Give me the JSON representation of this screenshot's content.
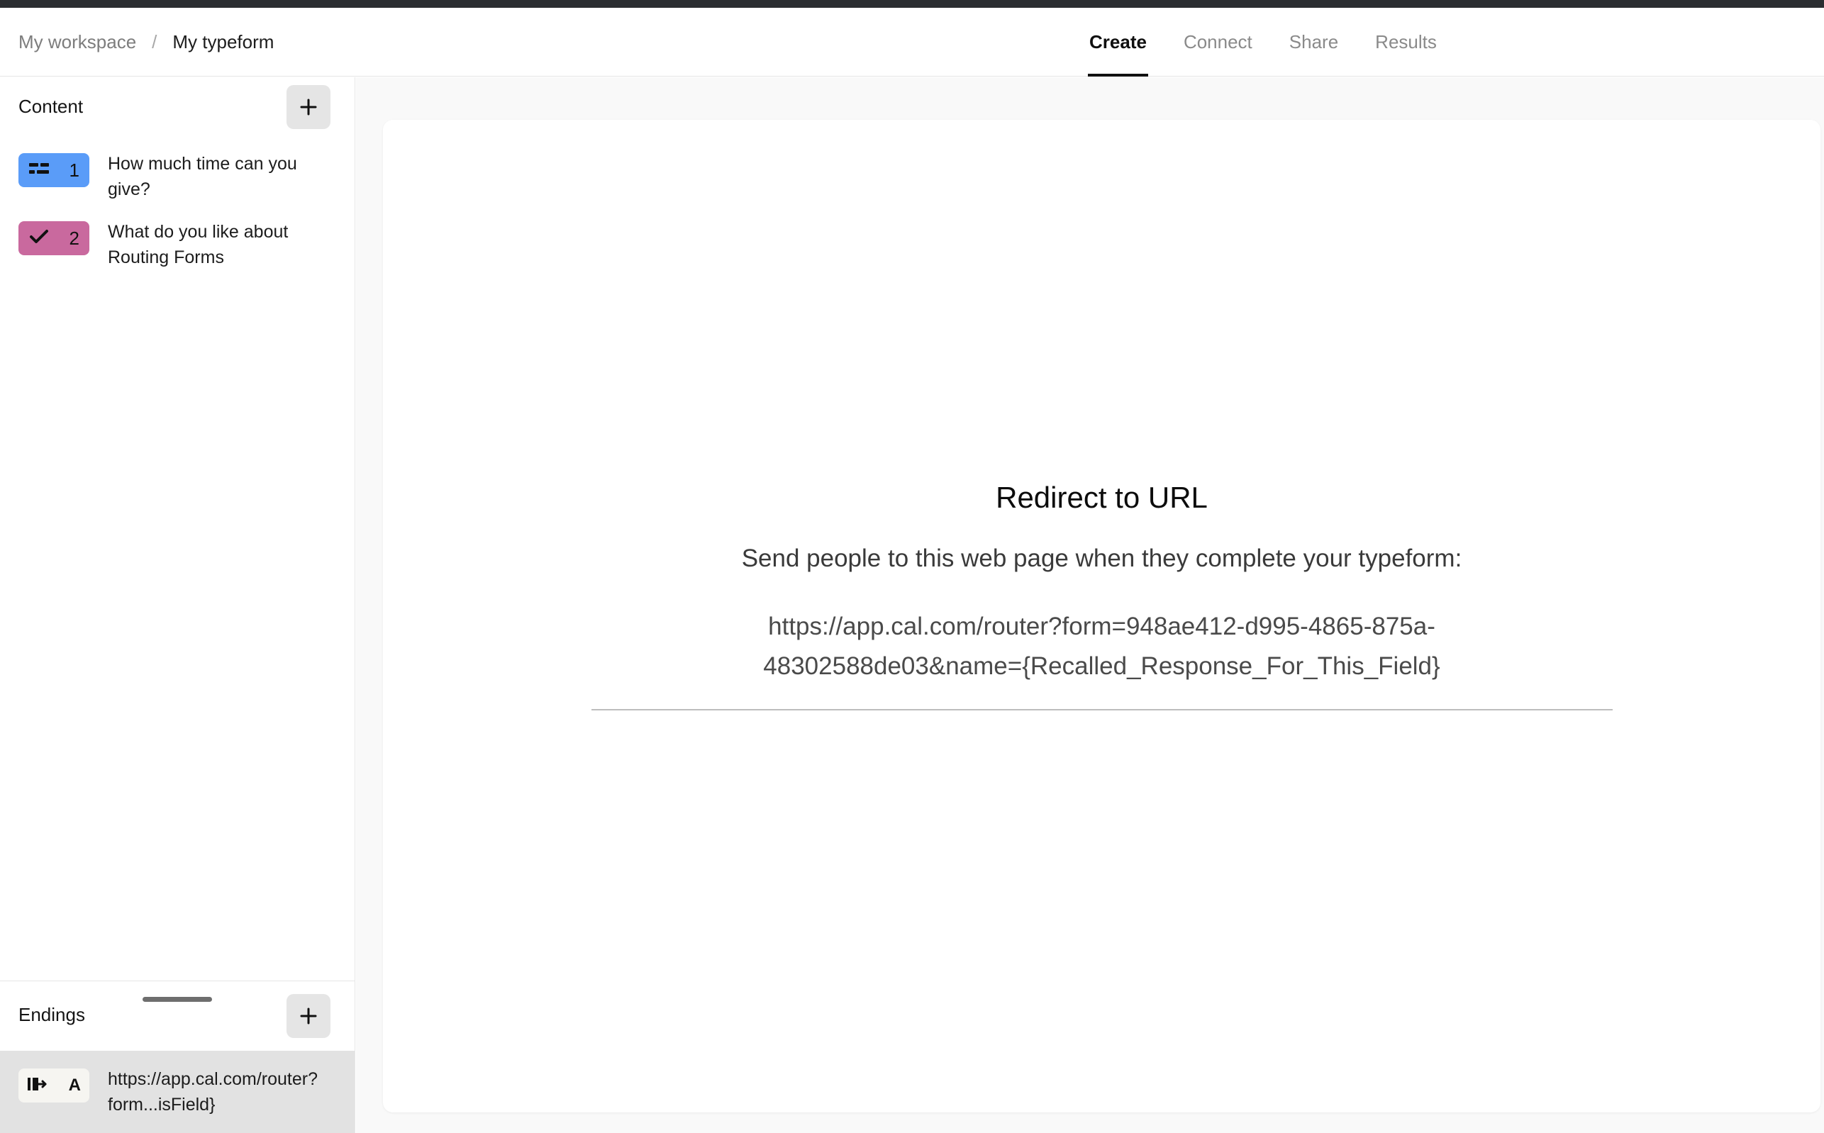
{
  "window": {
    "top_strip_color": "#2b2d31"
  },
  "header": {
    "breadcrumb": {
      "workspace": "My workspace",
      "separator": "/",
      "current": "My typeform"
    },
    "tabs": [
      {
        "label": "Create",
        "active": true
      },
      {
        "label": "Connect",
        "active": false
      },
      {
        "label": "Share",
        "active": false
      },
      {
        "label": "Results",
        "active": false
      }
    ]
  },
  "sidebar": {
    "content": {
      "title": "Content",
      "add_label": "+",
      "items": [
        {
          "number": "1",
          "icon": "multiple-choice-icon",
          "badge_color": "#5a9cf8",
          "label": "How much time can you give?"
        },
        {
          "number": "2",
          "icon": "checkmark-icon",
          "badge_color": "#c9699e",
          "label": "What do you like about Routing Forms"
        }
      ]
    },
    "endings": {
      "title": "Endings",
      "add_label": "+",
      "items": [
        {
          "letter": "A",
          "icon": "redirect-exit-icon",
          "badge_color": "#f6f5f1",
          "label": "https://app.cal.com/router?form...isField}",
          "selected": true
        }
      ]
    }
  },
  "canvas": {
    "ending_preview": {
      "title": "Redirect to URL",
      "subtitle": "Send people to this web page when they complete your typeform:",
      "url": "https://app.cal.com/router?form=948ae412-d995-4865-875a-48302588de03&name={Recalled_Response_For_This_Field}"
    }
  }
}
